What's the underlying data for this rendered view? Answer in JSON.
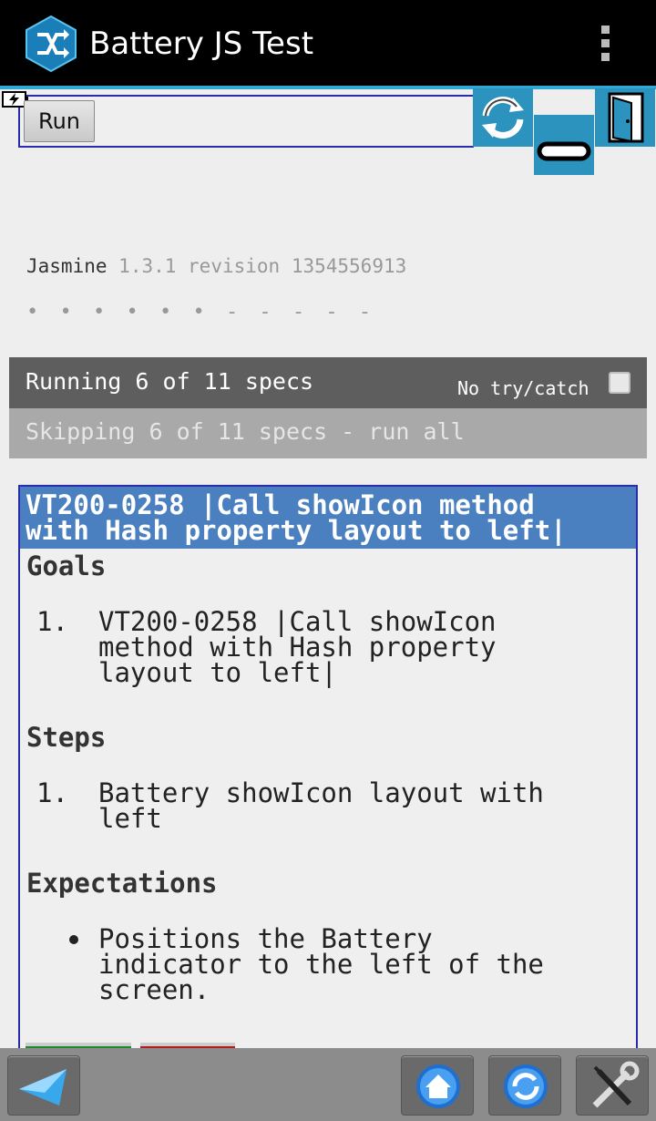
{
  "actionbar": {
    "title": "Battery JS Test"
  },
  "run": {
    "label": "Run"
  },
  "jasmine": {
    "name": "Jasmine",
    "version": "1.3.1 revision 1354556913"
  },
  "symbols": "• • • • • • - - - - -",
  "running": {
    "text": "Running 6 of 11 specs",
    "trycatch_label": "No try/catch",
    "trycatch_checked": false
  },
  "skipping": {
    "text": "Skipping 6 of 11 specs - run all"
  },
  "spec": {
    "title_line1": "VT200-0258 |Call showIcon method",
    "title_line2": "with Hash property layout to left|",
    "goals_title": "Goals",
    "goals": [
      {
        "num": "1.",
        "line1": "VT200-0258 |Call showIcon",
        "line2": "method with Hash property",
        "line3": "layout to left|"
      }
    ],
    "steps_title": "Steps",
    "steps": [
      {
        "num": "1.",
        "line1": "Battery showIcon layout with",
        "line2": "left"
      }
    ],
    "expectations_title": "Expectations",
    "expectations": [
      {
        "line1": "Positions the Battery",
        "line2": "indicator to the left of the",
        "line3": "screen."
      }
    ]
  },
  "icons": {
    "app": "cross-arrows-icon",
    "charging": "battery-charging-icon",
    "rotate": "rotate-icon",
    "minimize": "minimize-icon",
    "exit": "exit-door-icon",
    "back": "back-arrow-icon",
    "home": "home-icon",
    "refresh": "refresh-icon",
    "settings": "wrench-screwdriver-icon"
  },
  "colors": {
    "accent": "#2c93bf",
    "spec_header": "#4a7fc0",
    "running_bar": "#5e5e5e",
    "skip_bar": "#a9a9a9"
  }
}
